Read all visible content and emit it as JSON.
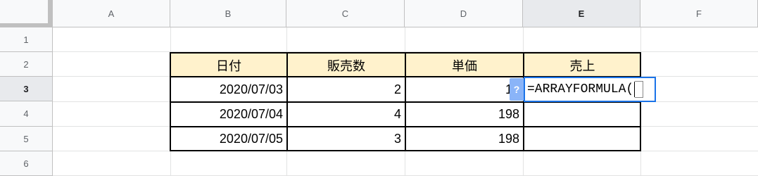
{
  "columns": [
    "A",
    "B",
    "C",
    "D",
    "E",
    "F"
  ],
  "rows": [
    "1",
    "2",
    "3",
    "4",
    "5",
    "6"
  ],
  "selected_column": "E",
  "selected_row": "3",
  "table": {
    "headers": [
      "日付",
      "販売数",
      "単価",
      "売上"
    ],
    "data": [
      [
        "2020/07/03",
        "2",
        "19",
        ""
      ],
      [
        "2020/07/04",
        "4",
        "198",
        ""
      ],
      [
        "2020/07/05",
        "3",
        "198",
        ""
      ]
    ]
  },
  "editor": {
    "formula": "=ARRAYFORMULA(",
    "help_glyph": "?"
  },
  "colors": {
    "header_fill": "#fff2cc",
    "selection": "#1a73e8",
    "help_chip": "#8ab4f8"
  }
}
